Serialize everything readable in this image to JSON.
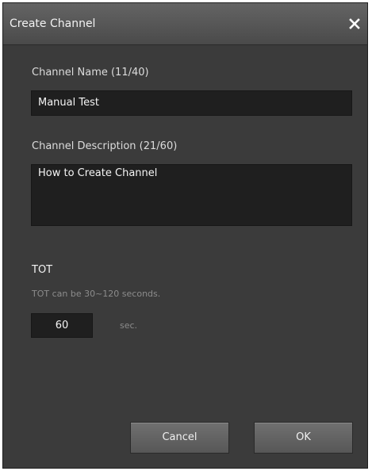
{
  "dialog": {
    "title": "Create Channel",
    "close_icon": "close-icon"
  },
  "channel_name": {
    "label": "Channel Name (11/40)",
    "value": "Manual Test"
  },
  "channel_description": {
    "label": "Channel Description (21/60)",
    "value": "How to Create Channel"
  },
  "tot": {
    "title": "TOT",
    "hint": "TOT can be 30~120 seconds.",
    "value": "60",
    "unit": "sec."
  },
  "buttons": {
    "cancel": "Cancel",
    "ok": "OK"
  },
  "colors": {
    "dialog_bg": "#3b3b3b",
    "field_bg": "#1f1f1f",
    "text": "#f2f2f2",
    "muted_text": "#8c8c8c"
  }
}
